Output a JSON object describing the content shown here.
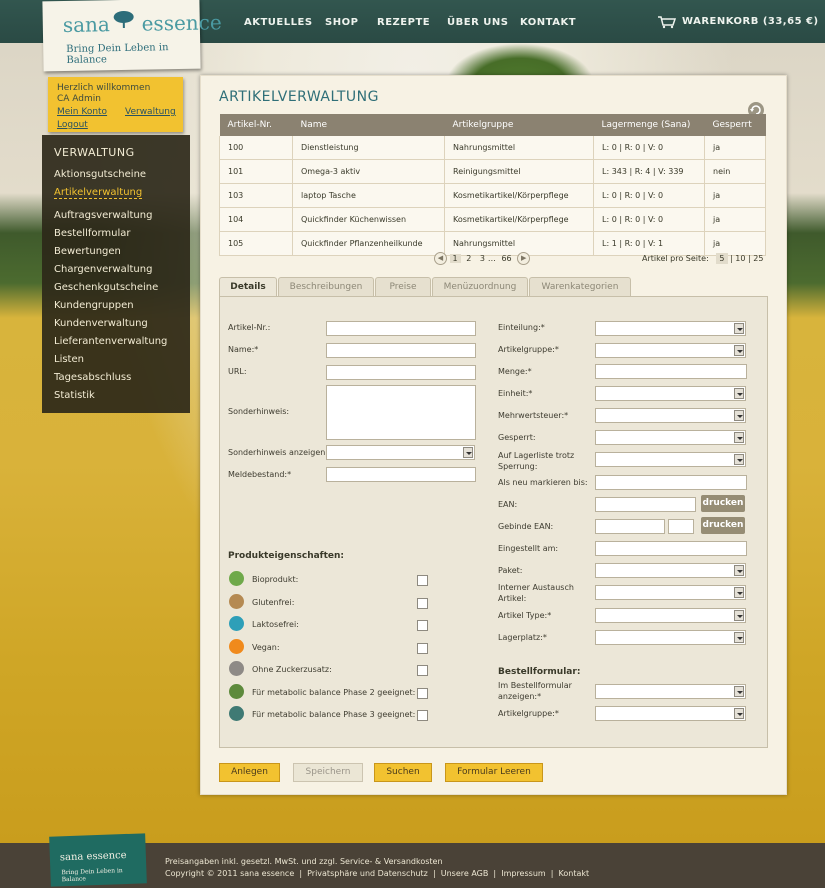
{
  "brand": {
    "name_left": "sana",
    "name_right": "essence",
    "tagline": "Bring Dein Leben in Balance"
  },
  "nav": [
    "AKTUELLES",
    "SHOP",
    "REZEPTE",
    "ÜBER UNS",
    "KONTAKT"
  ],
  "cart": "WARENKORB (33,65 €)",
  "welcome": {
    "greeting": "Herzlich willkommen",
    "user": "CA Admin",
    "my_account": "Mein Konto",
    "admin": "Verwaltung",
    "logout": "Logout"
  },
  "sidebar": {
    "heading": "VERWALTUNG",
    "items": [
      "Aktionsgutscheine",
      "Artikelverwaltung",
      "Auftragsverwaltung",
      "Bestellformular",
      "Bewertungen",
      "Chargenverwaltung",
      "Geschenkgutscheine",
      "Kundengruppen",
      "Kundenverwaltung",
      "Lieferantenverwaltung",
      "Listen",
      "Tagesabschluss",
      "Statistik"
    ]
  },
  "page_title": "ARTIKELVERWALTUNG",
  "table": {
    "headers": [
      "Artikel-Nr.",
      "Name",
      "Artikelgruppe",
      "Lagermenge (Sana)",
      "Gesperrt"
    ],
    "rows": [
      [
        "100",
        "Dienstleistung",
        "Nahrungsmittel",
        "L: 0 | R: 0 | V: 0",
        "ja"
      ],
      [
        "101",
        "Omega-3 aktiv",
        "Reinigungsmittel",
        "L: 343 | R: 4 | V: 339",
        "nein"
      ],
      [
        "103",
        "laptop Tasche",
        "Kosmetikartikel/Körperpflege",
        "L: 0 | R: 0 | V: 0",
        "ja"
      ],
      [
        "104",
        "Quickfinder Küchenwissen",
        "Kosmetikartikel/Körperpflege",
        "L: 0 | R: 0 | V: 0",
        "ja"
      ],
      [
        "105",
        "Quickfinder Pflanzenheilkunde",
        "Nahrungsmittel",
        "L: 1 | R: 0 | V: 1",
        "ja"
      ]
    ]
  },
  "pager": {
    "pages": [
      "1",
      "2",
      "3"
    ],
    "ellipsis": "…",
    "last": "66",
    "per_page_label": "Artikel pro Seite:",
    "per_page_options": [
      "5",
      "10",
      "25"
    ]
  },
  "tabs": [
    "Details",
    "Beschreibungen",
    "Preise",
    "Menüzuordnung",
    "Warenkategorien"
  ],
  "form_left": {
    "article_no": "Artikel-Nr.:",
    "name": "Name:*",
    "url": "URL:",
    "note": "Sonderhinweis:",
    "show_note": "Sonderhinweis anzeigen:",
    "min_stock": "Meldebestand:*"
  },
  "properties": {
    "heading": "Produkteigenschaften:",
    "items": [
      {
        "label": "Bioprodukt:",
        "icon": "leaf-icon",
        "color": "#6fa94a"
      },
      {
        "label": "Glutenfrei:",
        "icon": "wheat-icon",
        "color": "#b58a52"
      },
      {
        "label": "Laktosefrei:",
        "icon": "milk-icon",
        "color": "#2e9fb8"
      },
      {
        "label": "Vegan:",
        "icon": "vegan-icon",
        "color": "#f08a1c"
      },
      {
        "label": "Ohne Zuckerzusatz:",
        "icon": "sugar-icon",
        "color": "#8e8a86"
      },
      {
        "label": "Für metabolic balance Phase 2 geeignet:",
        "icon": "mb2-icon",
        "color": "#5d8a3c"
      },
      {
        "label": "Für metabolic balance Phase 3 geeignet:",
        "icon": "mb3-icon",
        "color": "#3f7a74"
      }
    ]
  },
  "form_right": {
    "classification": "Einteilung:*",
    "group": "Artikelgruppe:*",
    "quantity": "Menge:*",
    "unit": "Einheit:*",
    "vat": "Mehrwertsteuer:*",
    "locked": "Gesperrt:",
    "stocklist": "Auf Lagerliste trotz Sperrung:",
    "mark_new": "Als neu markieren bis:",
    "ean": "EAN:",
    "pack_ean": "Gebinde EAN:",
    "created": "Eingestellt am:",
    "package": "Paket:",
    "exchange": "Interner Austausch Artikel:",
    "type": "Artikel Type:*",
    "storage": "Lagerplatz:*",
    "print": "drucken"
  },
  "order_form": {
    "heading": "Bestellformular:",
    "show": "Im Bestellformular anzeigen:*",
    "group": "Artikelgruppe:*"
  },
  "actions": [
    "Anlegen",
    "Speichern",
    "Suchen",
    "Formular Leeren"
  ],
  "footer": {
    "line1": "Preisangaben inkl. gesetzl. MwSt. und zzgl. Service- & Versandkosten",
    "line2": "Copyright © 2011 sana essence  |  Privatsphäre und Datenschutz  |  Unsere AGB  |  Impressum  |  Kontakt"
  }
}
